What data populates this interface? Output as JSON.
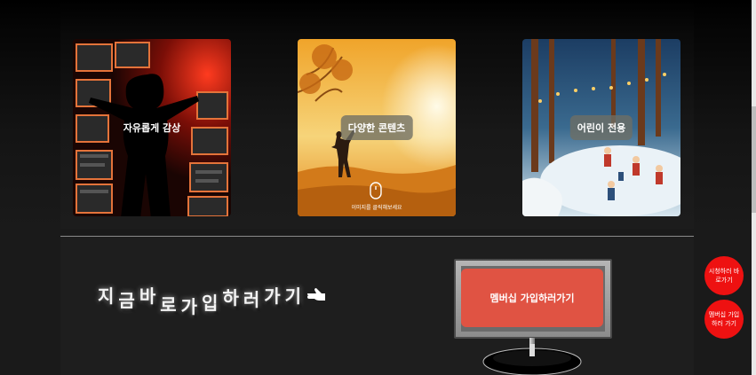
{
  "cards": [
    {
      "label": "자유롭게 감상"
    },
    {
      "label": "다양한 콘텐츠",
      "hint": "이미지를 클릭해보세요"
    },
    {
      "label": "어린이 전용"
    }
  ],
  "slogan": {
    "chars": [
      "지",
      "금",
      "바",
      "로",
      "가",
      "입",
      "하",
      "러",
      "가",
      "기"
    ],
    "icon": "pointing-hand-icon"
  },
  "signup": {
    "label": "멤버십 가입하러가기"
  },
  "floating": {
    "watch_label": "시청하러 바로가기",
    "join_label": "멤버십 가입하러 가기"
  },
  "colors": {
    "signup_button": "#e05343",
    "floating_button": "#ee1111"
  }
}
